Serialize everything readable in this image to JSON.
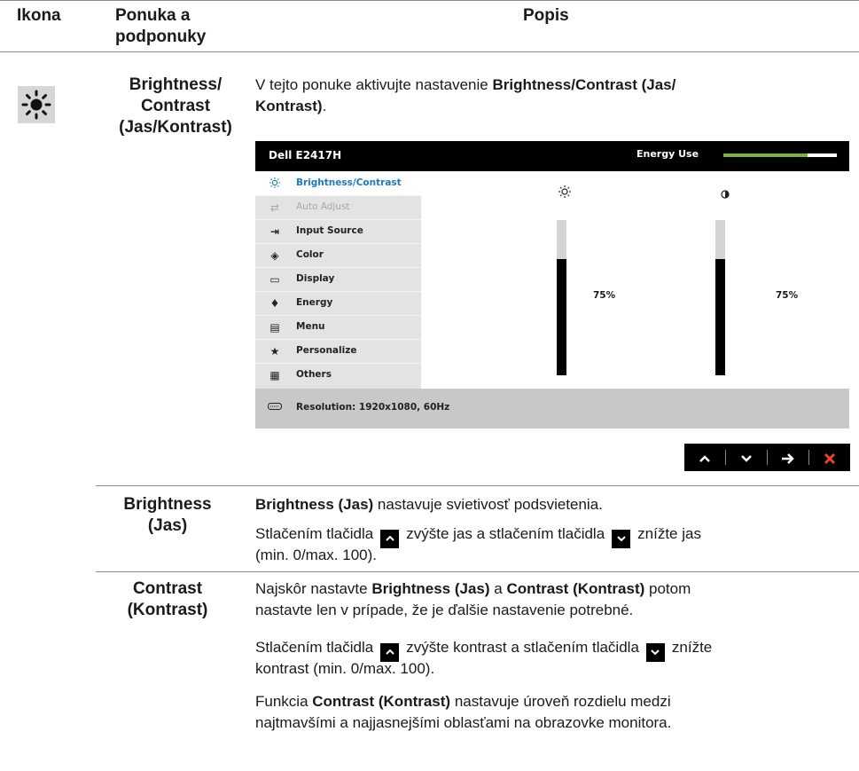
{
  "table": {
    "headers": {
      "icon": "Ikona",
      "menu_line1": "Ponuka a",
      "menu_line2": "podponuky",
      "desc": "Popis"
    }
  },
  "main_item": {
    "icon": "sun-icon",
    "name_line1": "Brightness/",
    "name_line2": "Contrast",
    "name_line3": "(Jas/Kontrast)",
    "intro_pre": "V tejto ponuke aktivujte nastavenie ",
    "intro_bold": "Brightness/Contrast (Jas/",
    "intro_bold2": "Kontrast)",
    "intro_post": "."
  },
  "osd": {
    "model": "Dell E2417H",
    "energy_label": "Energy Use",
    "energy_level": 0.74,
    "menu": [
      {
        "label": "Brightness/Contrast",
        "icon": "sun-icon",
        "state": "active"
      },
      {
        "label": "Auto Adjust",
        "icon": "auto-adjust-icon",
        "state": "disabled"
      },
      {
        "label": "Input Source",
        "icon": "input-source-icon",
        "state": "normal"
      },
      {
        "label": "Color",
        "icon": "color-icon",
        "state": "normal"
      },
      {
        "label": "Display",
        "icon": "display-icon",
        "state": "normal"
      },
      {
        "label": "Energy",
        "icon": "energy-icon",
        "state": "normal"
      },
      {
        "label": "Menu",
        "icon": "menu-icon",
        "state": "normal"
      },
      {
        "label": "Personalize",
        "icon": "star-icon",
        "state": "normal"
      },
      {
        "label": "Others",
        "icon": "others-icon",
        "state": "normal"
      }
    ],
    "brightness_value": "75%",
    "contrast_value": "75%",
    "brightness_level": 0.75,
    "contrast_level": 0.75,
    "status": "Resolution: 1920x1080, 60Hz"
  },
  "nav_buttons": [
    {
      "name": "up-button",
      "glyph": "^"
    },
    {
      "name": "down-button",
      "glyph": "v"
    },
    {
      "name": "right-button",
      "glyph": "→"
    },
    {
      "name": "close-button",
      "glyph": "✕"
    }
  ],
  "brightness": {
    "name_line1": "Brightness",
    "name_line2": "(Jas)",
    "desc1_bold": "Brightness (Jas)",
    "desc1_rest": " nastavuje svietivosť podsvietenia.",
    "desc2_a": "Stlačením tlačidla",
    "desc2_b": "zvýšte jas a stlačením tlačidla",
    "desc2_c": "znížte jas",
    "desc2_line2": "(min. 0/max. 100)."
  },
  "contrast": {
    "name_line1": "Contrast",
    "name_line2": "(Kontrast)",
    "p1_pre": "Najskôr nastavte ",
    "p1_b1": "Brightness (Jas)",
    "p1_mid": " a ",
    "p1_b2": "Contrast (Kontrast)",
    "p1_post": " potom",
    "p1_line2": "nastavte len v prípade, že je ďalšie nastavenie potrebné.",
    "p2_a": "Stlačením tlačidla",
    "p2_b": "zvýšte kontrast a stlačením tlačidla",
    "p2_c": "znížte",
    "p2_line2": "kontrast (min. 0/max. 100).",
    "p3_pre": "Funkcia ",
    "p3_bold": "Contrast (Kontrast)",
    "p3_post": " nastavuje úroveň rozdielu medzi",
    "p3_line2": "najtmavšími a najjasnejšími oblasťami na obrazovke monitora."
  }
}
